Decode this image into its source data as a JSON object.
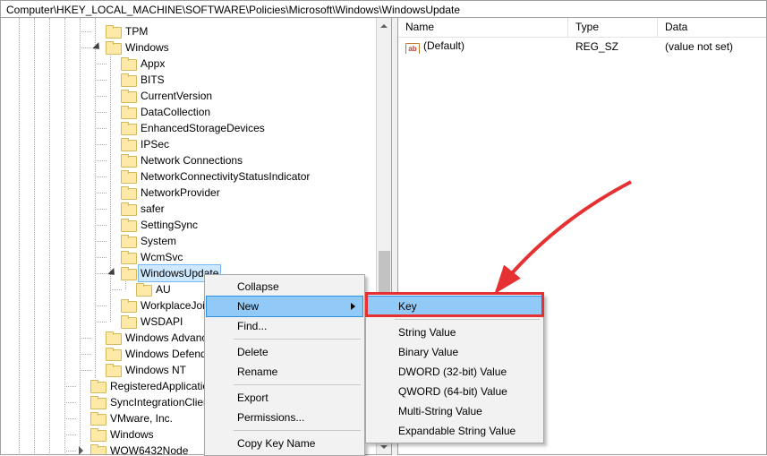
{
  "address_bar": "Computer\\HKEY_LOCAL_MACHINE\\SOFTWARE\\Policies\\Microsoft\\Windows\\WindowsUpdate",
  "tree": {
    "tpm": "TPM",
    "windows": "Windows",
    "children": {
      "appx": "Appx",
      "bits": "BITS",
      "currentversion": "CurrentVersion",
      "datacollection": "DataCollection",
      "enhancedstorage": "EnhancedStorageDevices",
      "ipsec": "IPSec",
      "netconn": "Network Connections",
      "netstatus": "NetworkConnectivityStatusIndicator",
      "netprovider": "NetworkProvider",
      "safer": "safer",
      "settingsync": "SettingSync",
      "system": "System",
      "wcmsvc": "WcmSvc",
      "windowsupdate": "WindowsUpdate",
      "au": "AU",
      "workplacejoin": "WorkplaceJoin",
      "wsdapi": "WSDAPI"
    },
    "windows_advance": "Windows Advance",
    "windows_defender": "Windows Defender",
    "windows_nt": "Windows NT",
    "registeredapps": "RegisteredApplications",
    "syncintegration": "SyncIntegrationClients",
    "vmware": "VMware, Inc.",
    "windows2": "Windows",
    "wow64": "WOW6432Node"
  },
  "values_header": {
    "name": "Name",
    "type": "Type",
    "data": "Data"
  },
  "default_row": {
    "name": "(Default)",
    "type": "REG_SZ",
    "data": "(value not set)"
  },
  "context_menu": {
    "collapse": "Collapse",
    "new": "New",
    "find": "Find...",
    "delete": "Delete",
    "rename": "Rename",
    "export": "Export",
    "permissions": "Permissions...",
    "copy_key_name": "Copy Key Name"
  },
  "new_submenu": {
    "key": "Key",
    "string": "String Value",
    "binary": "Binary Value",
    "dword": "DWORD (32-bit) Value",
    "qword": "QWORD (64-bit) Value",
    "multi": "Multi-String Value",
    "expand": "Expandable String Value"
  },
  "annotation": {
    "color": "#e53131"
  }
}
